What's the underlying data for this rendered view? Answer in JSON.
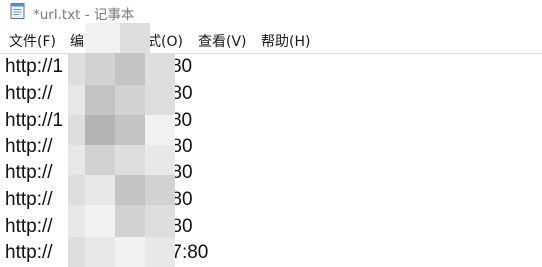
{
  "window": {
    "title": "*url.txt - 记事本",
    "title_icon": "notepad-icon"
  },
  "menu": [
    {
      "label": "文件(F)"
    },
    {
      "label": "编辑(E)"
    },
    {
      "label": "格式(O)"
    },
    {
      "label": "查看(V)"
    },
    {
      "label": "帮助(H)"
    }
  ],
  "document": {
    "lines": [
      {
        "prefix": "http://1",
        "suffix": "7:80"
      },
      {
        "prefix": "http://",
        "suffix": "6:80"
      },
      {
        "prefix": "http://1",
        "suffix": "3:80"
      },
      {
        "prefix": "http://",
        "suffix": "5:80"
      },
      {
        "prefix": "http://",
        "suffix": "4:80"
      },
      {
        "prefix": "http://",
        "suffix": "3:80"
      },
      {
        "prefix": "http://",
        "suffix": "1:80"
      },
      {
        "prefix": "http://",
        "suffix": ".87:80"
      }
    ]
  },
  "colors": {
    "title_text": "#7a7a7a",
    "menu_text": "#1a1a1a",
    "editor_text": "#111111",
    "mosaic_shades": [
      "#b4b4b4",
      "#c4c4c4",
      "#d2d2d2",
      "#dedede",
      "#e8e8e8",
      "#f2f2f2"
    ]
  },
  "redaction": "pixelated-mosaic"
}
